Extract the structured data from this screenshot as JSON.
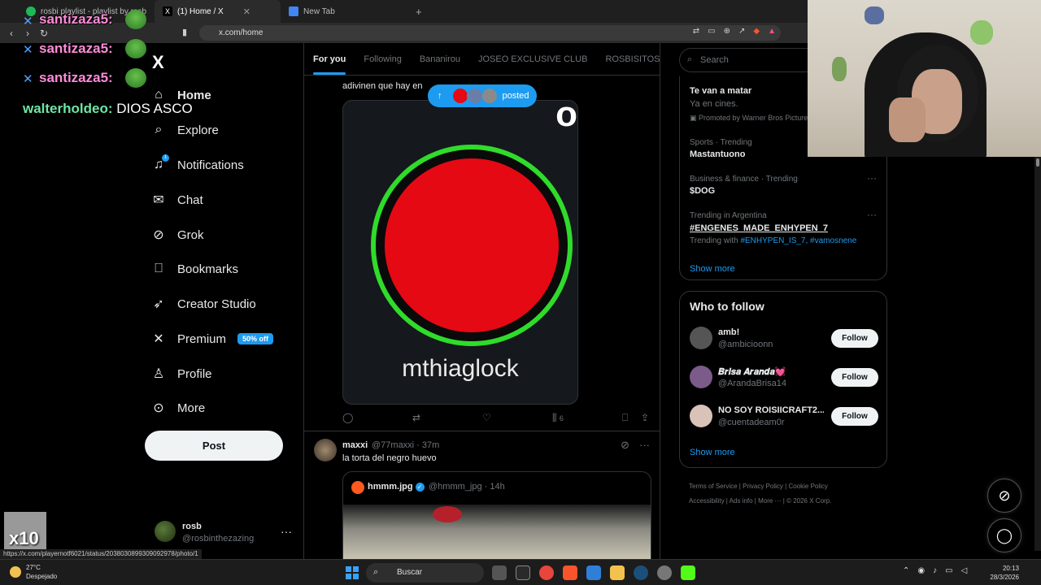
{
  "browser": {
    "tabs": [
      {
        "label": "rosbi playlist - playlist by rosb",
        "color": "#1DB954"
      },
      {
        "label": "(1) Home / X",
        "color": "#ffffff"
      },
      {
        "label": "New Tab",
        "color": "#4285f4"
      }
    ],
    "close_glyph": "✕",
    "new_tab_glyph": "+",
    "url": "x.com/home",
    "status_url": "https://x.com/playernotf6021/status/2038030899309092978/photo/1"
  },
  "nav": {
    "logo": "X",
    "items": [
      {
        "label": "Home",
        "icon": "home-icon"
      },
      {
        "label": "Explore",
        "icon": "search-icon"
      },
      {
        "label": "Notifications",
        "icon": "bell-icon",
        "badge": "1"
      },
      {
        "label": "Chat",
        "icon": "mail-icon"
      },
      {
        "label": "Grok",
        "icon": "grok-icon"
      },
      {
        "label": "Bookmarks",
        "icon": "bookmark-icon"
      },
      {
        "label": "Creator Studio",
        "icon": "rocket-icon"
      },
      {
        "label": "Premium",
        "icon": "x-icon",
        "badge": "50% off"
      },
      {
        "label": "Profile",
        "icon": "person-icon"
      },
      {
        "label": "More",
        "icon": "more-circle-icon"
      }
    ],
    "post_label": "Post",
    "account": {
      "name": "rosb",
      "handle": "@rosbinthezazing"
    }
  },
  "timeline": {
    "tabs": [
      "For you",
      "Following",
      "Bananirou",
      "JOSEO EXCLUSIVE CLUB",
      "ROSBISITOS"
    ],
    "posted_pill": "posted",
    "tweet1": {
      "text": "adivinen que hay en",
      "text_tail": "o",
      "media_text": "mthiaglock",
      "views": "6"
    },
    "tweet2": {
      "name": "maxxi",
      "handle": "@77maxxi",
      "time": "37m",
      "text": "la torta del negro huevo",
      "quote": {
        "name": "hmmm.jpg",
        "handle": "@hmmm_jpg",
        "time": "14h"
      }
    }
  },
  "right": {
    "search_placeholder": "Search",
    "trends": [
      {
        "meta": "",
        "title": "Te van a matar",
        "sub": "Ya en cines.",
        "promo": "Promoted by Warner Bros Pictures"
      },
      {
        "meta": "Sports · Trending",
        "title": "Mastantuono"
      },
      {
        "meta": "Business & finance · Trending",
        "title": "$DOG"
      },
      {
        "meta": "Trending in Argentina",
        "title": "#ENGENES_MADE_ENHYPEN_7",
        "with_label": "Trending with",
        "with_links": "#ENHYPEN_IS_7, #vamosnene"
      }
    ],
    "show_more": "Show more",
    "who_to_follow": {
      "title": "Who to follow",
      "accounts": [
        {
          "name": "amb!",
          "handle": "@ambicioonn",
          "color": "#555555"
        },
        {
          "name": "𝑩𝒓𝒊𝒔𝒂 𝑨𝒓𝒂𝒏𝒅𝒂💓",
          "handle": "@ArandaBrisa14",
          "color": "#7a5b8a"
        },
        {
          "name": "NO SOY ROISIICRAFT2...",
          "handle": "@cuentadeam0r",
          "color": "#d9c2b8"
        }
      ],
      "follow_label": "Follow",
      "show_more": "Show more"
    },
    "footer": [
      "Terms of Service",
      "Privacy Policy",
      "Cookie Policy",
      "Accessibility",
      "Ads info",
      "More ···",
      "© 2026 X Corp."
    ]
  },
  "chat_overlay": [
    {
      "user": "santizaza5:"
    },
    {
      "user": "santizaza5:"
    },
    {
      "user": "santizaza5:"
    },
    {
      "user": "walterholdeo:",
      "message": "DIOS ASCO"
    }
  ],
  "mini_cam_label": "x10",
  "taskbar": {
    "weather_temp": "27°C",
    "weather_desc": "Despejado",
    "search_label": "Buscar",
    "time": "20:13",
    "date": "28/3/2026"
  }
}
